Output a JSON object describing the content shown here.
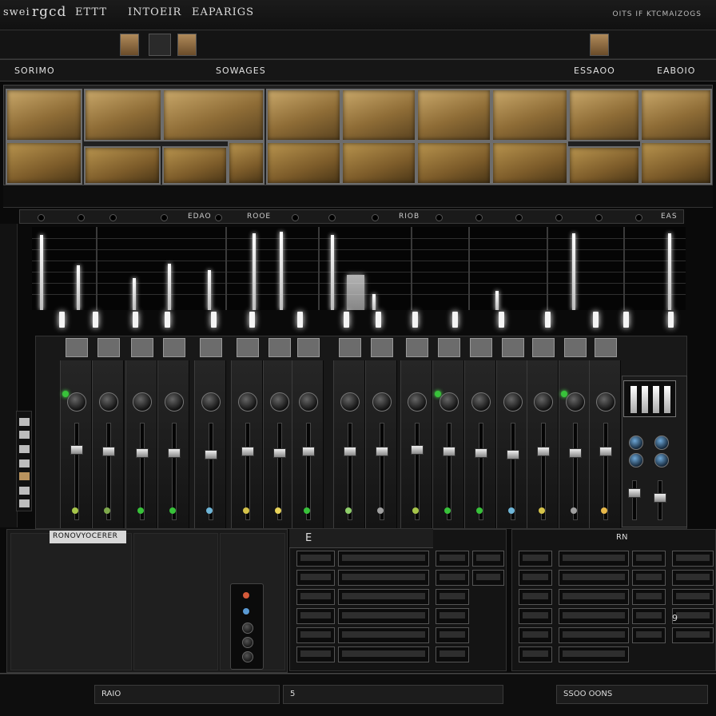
{
  "menubar": {
    "items": [
      "swei",
      "rgcd",
      "ETTT",
      "INTOEIR",
      "EAPARIGS"
    ],
    "right_text": "OITS IF KTCMAIZOGS"
  },
  "sections": {
    "left": "SORIMO",
    "center": "SOWAGES",
    "right1": "ESSAOO",
    "right2": "EABOIO"
  },
  "channel_header": {
    "labels": [
      "EDAO",
      "ROOE",
      "RIOB",
      "EAS"
    ]
  },
  "bottom_left": {
    "title": "RONOVYOCERER"
  },
  "rack": {
    "header": "E",
    "right_label": "9"
  },
  "bottom_right": {
    "header": "RN",
    "label": "9"
  },
  "status": {
    "left": "RAIO",
    "mid": "5",
    "right": "SSOO OONS"
  },
  "colors": {
    "pad_gold": "#c9a86a",
    "led_green": "#38c23a",
    "knob_blue": "#6ea7d6",
    "background": "#0a0a0a"
  }
}
